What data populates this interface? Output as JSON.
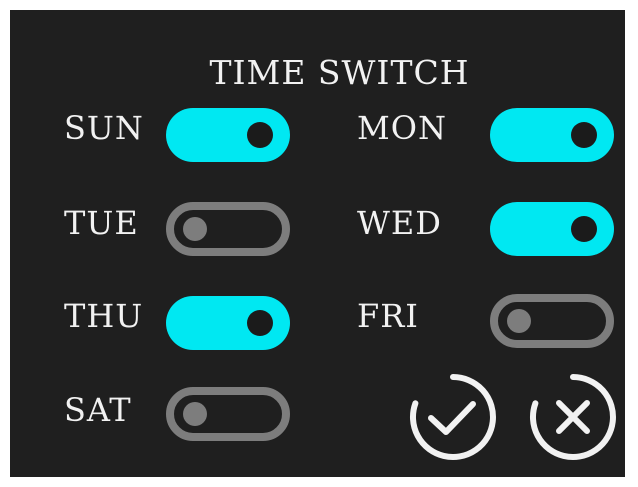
{
  "title": "TIME SWITCH",
  "colors": {
    "background": "#1f1f1f",
    "toggle_on": "#00e8f2",
    "toggle_off": "#7d7d7d",
    "text": "#f2f2f2"
  },
  "days": [
    {
      "label": "SUN",
      "on": true
    },
    {
      "label": "MON",
      "on": true
    },
    {
      "label": "TUE",
      "on": false
    },
    {
      "label": "WED",
      "on": true
    },
    {
      "label": "THU",
      "on": true
    },
    {
      "label": "FRI",
      "on": false
    },
    {
      "label": "SAT",
      "on": false
    }
  ],
  "actions": {
    "confirm_icon": "check-circle-icon",
    "cancel_icon": "x-circle-icon"
  }
}
